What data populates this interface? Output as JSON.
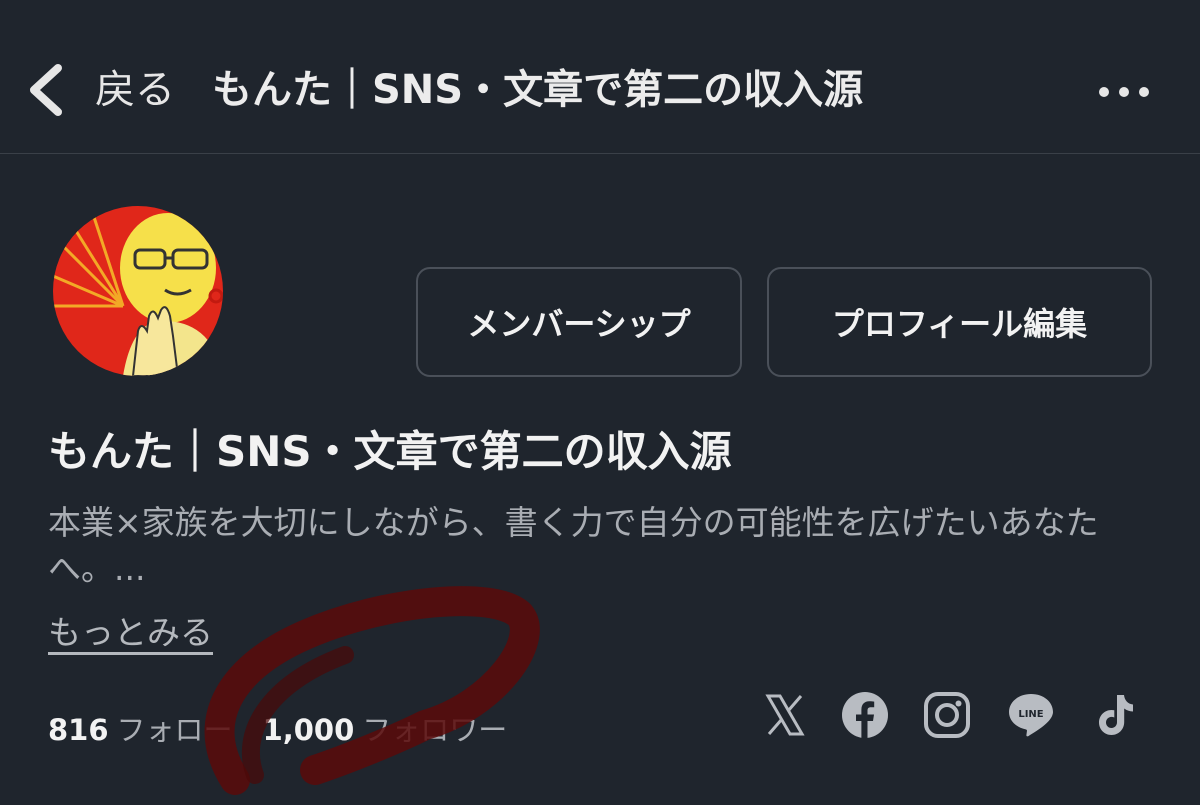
{
  "header": {
    "back_label": "戻る",
    "title": "もんた｜SNS・文章で第二の収入源",
    "more_icon": "more-horizontal-icon"
  },
  "profile": {
    "avatar_icon": "user-avatar",
    "membership_button": "メンバーシップ",
    "edit_profile_button": "プロフィール編集",
    "name": "もんた｜SNS・文章で第二の収入源",
    "bio": "本業×家族を大切にしながら、書く力で自分の可能性を広げたいあなたへ。...",
    "more_link": "もっとみる"
  },
  "stats": {
    "following_count": "816",
    "following_label": "フォロー",
    "followers_count": "1,000",
    "followers_label": "フォロワー"
  },
  "social": {
    "icons": [
      "x-icon",
      "facebook-icon",
      "instagram-icon",
      "line-icon",
      "tiktok-icon"
    ],
    "line_text": "LINE"
  },
  "colors": {
    "background": "#1f252d",
    "text_primary": "#f2f2f2",
    "text_secondary": "#a9adb3",
    "button_border": "#4a5059",
    "scribble": "#5a0a0a",
    "avatar_red": "#e0271a",
    "avatar_yellow": "#f6e04a"
  }
}
